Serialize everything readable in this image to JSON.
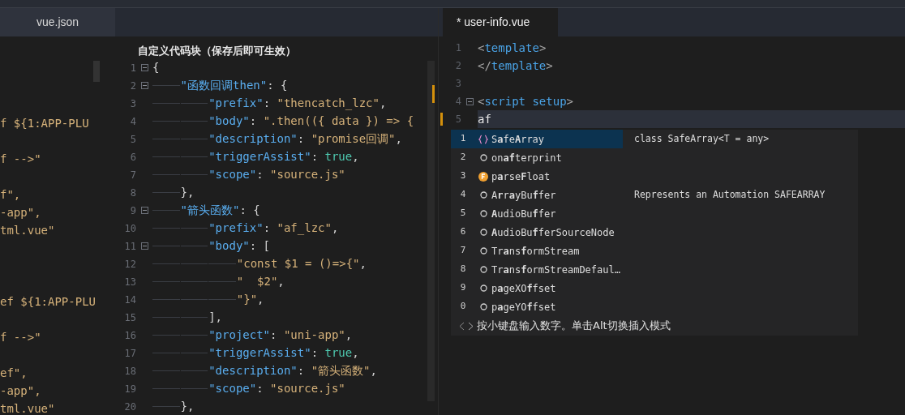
{
  "left_tabs": [
    {
      "label": "vue.json",
      "selected": true
    }
  ],
  "left_fragments": [
    {
      "kind": "blank"
    },
    {
      "kind": "blank"
    },
    {
      "kind": "blank"
    },
    {
      "kind": "text",
      "text": "f ${1:APP-PLU"
    },
    {
      "kind": "blank"
    },
    {
      "kind": "text",
      "text": "f -->\""
    },
    {
      "kind": "blank"
    },
    {
      "kind": "text",
      "text": "f\","
    },
    {
      "kind": "text",
      "text": "-app\","
    },
    {
      "kind": "text",
      "text": "tml.vue\""
    },
    {
      "kind": "blank"
    },
    {
      "kind": "blank"
    },
    {
      "kind": "blank"
    },
    {
      "kind": "text",
      "text": "ef ${1:APP-PLU"
    },
    {
      "kind": "blank"
    },
    {
      "kind": "text",
      "text": "f -->\""
    },
    {
      "kind": "blank"
    },
    {
      "kind": "text",
      "text": "ef\","
    },
    {
      "kind": "text",
      "text": "-app\","
    },
    {
      "kind": "text",
      "text": "tml.vue\""
    }
  ],
  "snippet_panel": {
    "heading": "自定义代码块（保存后即可生效）",
    "lines": [
      {
        "no": "1",
        "fold": true,
        "tokens": [
          {
            "kind": "punct",
            "text": "{"
          }
        ]
      },
      {
        "no": "2",
        "fold": true,
        "guides": [
          {
            "kind": "dash"
          }
        ],
        "tokens": [
          {
            "kind": "key",
            "text": "\"函数回调then\""
          },
          {
            "kind": "punct",
            "text": ": {"
          }
        ]
      },
      {
        "no": "3",
        "fold": false,
        "guides": [
          {
            "kind": "dash"
          },
          {
            "kind": "dash"
          }
        ],
        "tokens": [
          {
            "kind": "key",
            "text": "\"prefix\""
          },
          {
            "kind": "punct",
            "text": ": "
          },
          {
            "kind": "string",
            "text": "\"thencatch_lzc\""
          },
          {
            "kind": "punct",
            "text": ","
          }
        ]
      },
      {
        "no": "4",
        "fold": false,
        "guides": [
          {
            "kind": "dash"
          },
          {
            "kind": "dash"
          }
        ],
        "tokens": [
          {
            "kind": "key",
            "text": "\"body\""
          },
          {
            "kind": "punct",
            "text": ": "
          },
          {
            "kind": "string",
            "text": "\".then(({ data }) => {"
          }
        ]
      },
      {
        "no": "5",
        "fold": false,
        "guides": [
          {
            "kind": "dash"
          },
          {
            "kind": "dash"
          }
        ],
        "tokens": [
          {
            "kind": "key",
            "text": "\"description\""
          },
          {
            "kind": "punct",
            "text": ": "
          },
          {
            "kind": "string",
            "text": "\"promise回调\""
          },
          {
            "kind": "punct",
            "text": ","
          }
        ]
      },
      {
        "no": "6",
        "fold": false,
        "guides": [
          {
            "kind": "dash"
          },
          {
            "kind": "dash"
          }
        ],
        "tokens": [
          {
            "kind": "key",
            "text": "\"triggerAssist\""
          },
          {
            "kind": "punct",
            "text": ": "
          },
          {
            "kind": "bool",
            "text": "true"
          },
          {
            "kind": "punct",
            "text": ","
          }
        ]
      },
      {
        "no": "7",
        "fold": false,
        "guides": [
          {
            "kind": "dash"
          },
          {
            "kind": "dash"
          }
        ],
        "tokens": [
          {
            "kind": "key",
            "text": "\"scope\""
          },
          {
            "kind": "punct",
            "text": ": "
          },
          {
            "kind": "string",
            "text": "\"source.js\""
          }
        ]
      },
      {
        "no": "8",
        "fold": false,
        "guides": [
          {
            "kind": "dash"
          }
        ],
        "tokens": [
          {
            "kind": "punct",
            "text": "},"
          }
        ]
      },
      {
        "no": "9",
        "fold": true,
        "guides": [
          {
            "kind": "dash"
          }
        ],
        "tokens": [
          {
            "kind": "key",
            "text": "\"箭头函数\""
          },
          {
            "kind": "punct",
            "text": ": {"
          }
        ]
      },
      {
        "no": "10",
        "fold": false,
        "guides": [
          {
            "kind": "dash"
          },
          {
            "kind": "dash"
          }
        ],
        "tokens": [
          {
            "kind": "key",
            "text": "\"prefix\""
          },
          {
            "kind": "punct",
            "text": ": "
          },
          {
            "kind": "string",
            "text": "\"af_lzc\""
          },
          {
            "kind": "punct",
            "text": ","
          }
        ]
      },
      {
        "no": "11",
        "fold": true,
        "guides": [
          {
            "kind": "dash"
          },
          {
            "kind": "dash"
          }
        ],
        "tokens": [
          {
            "kind": "key",
            "text": "\"body\""
          },
          {
            "kind": "punct",
            "text": ": ["
          }
        ]
      },
      {
        "no": "12",
        "fold": false,
        "guides": [
          {
            "kind": "dash"
          },
          {
            "kind": "dash"
          },
          {
            "kind": "dash"
          }
        ],
        "tokens": [
          {
            "kind": "string",
            "text": "\"const $1 = ()=>{\""
          },
          {
            "kind": "punct",
            "text": ","
          }
        ]
      },
      {
        "no": "13",
        "fold": false,
        "guides": [
          {
            "kind": "dash"
          },
          {
            "kind": "dash"
          },
          {
            "kind": "dash"
          }
        ],
        "tokens": [
          {
            "kind": "string",
            "text": "\"  $2\""
          },
          {
            "kind": "punct",
            "text": ","
          }
        ]
      },
      {
        "no": "14",
        "fold": false,
        "guides": [
          {
            "kind": "dash"
          },
          {
            "kind": "dash"
          },
          {
            "kind": "dash"
          }
        ],
        "tokens": [
          {
            "kind": "string",
            "text": "\"}\""
          },
          {
            "kind": "punct",
            "text": ","
          }
        ]
      },
      {
        "no": "15",
        "fold": false,
        "guides": [
          {
            "kind": "dash"
          },
          {
            "kind": "dash"
          }
        ],
        "tokens": [
          {
            "kind": "punct",
            "text": "],"
          }
        ]
      },
      {
        "no": "16",
        "fold": false,
        "guides": [
          {
            "kind": "dash"
          },
          {
            "kind": "dash"
          }
        ],
        "tokens": [
          {
            "kind": "key",
            "text": "\"project\""
          },
          {
            "kind": "punct",
            "text": ": "
          },
          {
            "kind": "string",
            "text": "\"uni-app\""
          },
          {
            "kind": "punct",
            "text": ","
          }
        ]
      },
      {
        "no": "17",
        "fold": false,
        "guides": [
          {
            "kind": "dash"
          },
          {
            "kind": "dash"
          }
        ],
        "tokens": [
          {
            "kind": "key",
            "text": "\"triggerAssist\""
          },
          {
            "kind": "punct",
            "text": ": "
          },
          {
            "kind": "bool",
            "text": "true"
          },
          {
            "kind": "punct",
            "text": ","
          }
        ]
      },
      {
        "no": "18",
        "fold": false,
        "guides": [
          {
            "kind": "dash"
          },
          {
            "kind": "dash"
          }
        ],
        "tokens": [
          {
            "kind": "key",
            "text": "\"description\""
          },
          {
            "kind": "punct",
            "text": ": "
          },
          {
            "kind": "string",
            "text": "\"箭头函数\""
          },
          {
            "kind": "punct",
            "text": ","
          }
        ]
      },
      {
        "no": "19",
        "fold": false,
        "guides": [
          {
            "kind": "dash"
          },
          {
            "kind": "dash"
          }
        ],
        "tokens": [
          {
            "kind": "key",
            "text": "\"scope\""
          },
          {
            "kind": "punct",
            "text": ": "
          },
          {
            "kind": "string",
            "text": "\"source.js\""
          }
        ]
      },
      {
        "no": "20",
        "fold": false,
        "guides": [
          {
            "kind": "dash"
          }
        ],
        "tokens": [
          {
            "kind": "punct",
            "text": "},"
          }
        ]
      }
    ]
  },
  "editor": {
    "tab": {
      "label": "* user-info.vue",
      "selected": true
    },
    "lines": [
      {
        "no": "1",
        "fold": false,
        "current": false,
        "tokens": [
          {
            "kind": "bracket",
            "text": "<"
          },
          {
            "kind": "tag",
            "text": "template"
          },
          {
            "kind": "bracket",
            "text": ">"
          }
        ]
      },
      {
        "no": "2",
        "fold": false,
        "current": false,
        "tokens": [
          {
            "kind": "bracket",
            "text": "</"
          },
          {
            "kind": "tag",
            "text": "template"
          },
          {
            "kind": "bracket",
            "text": ">"
          }
        ]
      },
      {
        "no": "3",
        "fold": false,
        "current": false
      },
      {
        "no": "4",
        "fold": true,
        "current": false,
        "tokens": [
          {
            "kind": "bracket",
            "text": "<"
          },
          {
            "kind": "tag",
            "text": "script setup"
          },
          {
            "kind": "bracket",
            "text": ">"
          }
        ]
      },
      {
        "no": "5",
        "fold": false,
        "current": true,
        "tokens": [
          {
            "kind": "plain",
            "text": "af"
          }
        ]
      }
    ],
    "suggestions": {
      "items": [
        {
          "key": "1",
          "kind": "class",
          "label": "S**a**fe**A**rray",
          "detail": "class SafeArray<T = any>",
          "selected": true
        },
        {
          "key": "2",
          "kind": "variable",
          "label": "on**af**terprint",
          "selected": false
        },
        {
          "key": "3",
          "kind": "function",
          "label": "p**a**rse**F**loat",
          "selected": false
        },
        {
          "key": "4",
          "kind": "variable",
          "label": "A**r**r**a**yBu**f**fer",
          "detail": "Represents an Automation SAFEARRAY",
          "selected": false
        },
        {
          "key": "5",
          "kind": "variable",
          "label": "**A**udioBu**f**fer",
          "selected": false
        },
        {
          "key": "6",
          "kind": "variable",
          "label": "**A**udioBu**f**ferSourceNode",
          "selected": false
        },
        {
          "key": "7",
          "kind": "variable",
          "label": "Tr**a**ns**f**ormStream",
          "selected": false
        },
        {
          "key": "8",
          "kind": "variable",
          "label": "Tr**a**ns**f**ormStreamDefaul…",
          "selected": false
        },
        {
          "key": "9",
          "kind": "variable",
          "label": "p**a**geXO**f**fset",
          "selected": false
        },
        {
          "key": "0",
          "kind": "variable",
          "label": "p**a**geYO**f**fset",
          "selected": false
        }
      ],
      "hint": "按小键盘输入数字。单击Alt切换插入模式"
    }
  }
}
